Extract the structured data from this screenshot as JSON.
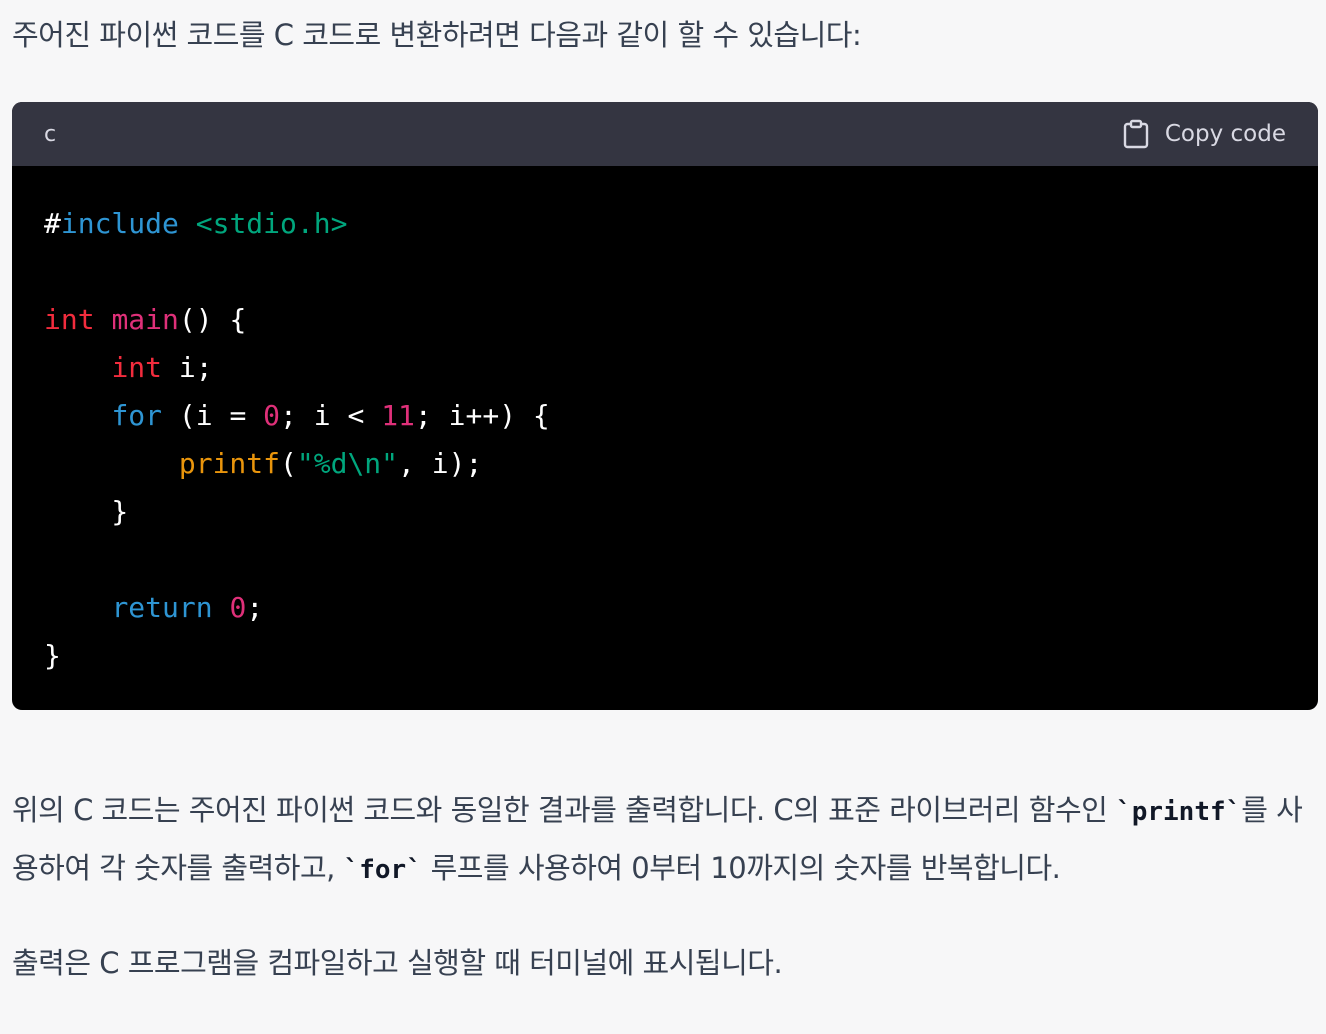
{
  "intro": "주어진 파이썬 코드를 C 코드로 변환하려면 다음과 같이 할 수 있습니다:",
  "code_block": {
    "language": "c",
    "copy_label": "Copy code",
    "copy_icon": "clipboard-icon",
    "lines": [
      [
        {
          "t": "#",
          "c": "plain"
        },
        {
          "t": "include",
          "c": "meta"
        },
        {
          "t": " ",
          "c": "plain"
        },
        {
          "t": "<stdio.h>",
          "c": "str"
        }
      ],
      [],
      [
        {
          "t": "int",
          "c": "type"
        },
        {
          "t": " ",
          "c": "plain"
        },
        {
          "t": "main",
          "c": "func"
        },
        {
          "t": "() {",
          "c": "plain"
        }
      ],
      [
        {
          "t": "    ",
          "c": "plain"
        },
        {
          "t": "int",
          "c": "type"
        },
        {
          "t": " i;",
          "c": "plain"
        }
      ],
      [
        {
          "t": "    ",
          "c": "plain"
        },
        {
          "t": "for",
          "c": "kw"
        },
        {
          "t": " (i = ",
          "c": "plain"
        },
        {
          "t": "0",
          "c": "num"
        },
        {
          "t": "; i < ",
          "c": "plain"
        },
        {
          "t": "11",
          "c": "num"
        },
        {
          "t": "; i++) {",
          "c": "plain"
        }
      ],
      [
        {
          "t": "        ",
          "c": "plain"
        },
        {
          "t": "printf",
          "c": "call"
        },
        {
          "t": "(",
          "c": "plain"
        },
        {
          "t": "\"%d\\n\"",
          "c": "str"
        },
        {
          "t": ", i);",
          "c": "plain"
        }
      ],
      [
        {
          "t": "    }",
          "c": "plain"
        }
      ],
      [],
      [
        {
          "t": "    ",
          "c": "plain"
        },
        {
          "t": "return",
          "c": "kw"
        },
        {
          "t": " ",
          "c": "plain"
        },
        {
          "t": "0",
          "c": "num"
        },
        {
          "t": ";",
          "c": "plain"
        }
      ],
      [
        {
          "t": "}",
          "c": "plain"
        }
      ]
    ]
  },
  "explanation": {
    "part1": "위의 C 코드는 주어진 파이썬 코드와 동일한 결과를 출력합니다. C의 표준 라이브러리 함수인 ",
    "code1": "`printf`",
    "part2": "를 사용하여 각 숫자를 출력하고, ",
    "code2": "`for`",
    "part3": " 루프를 사용하여 0부터 10까지의 숫자를 반복합니다."
  },
  "output_note": "출력은 C 프로그램을 컴파일하고 실행할 때 터미널에 표시됩니다.",
  "colors": {
    "background": "#f7f7f8",
    "text": "#374151",
    "code_header": "#343541",
    "code_body": "#000000"
  }
}
